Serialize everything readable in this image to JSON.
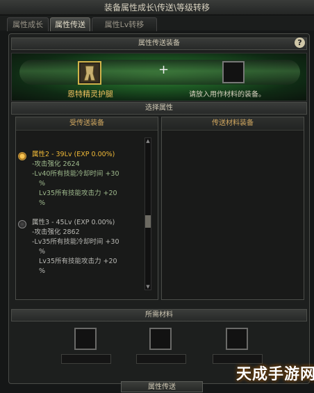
{
  "window": {
    "title": "装备属性成长\\传送\\等级转移"
  },
  "tabs": [
    {
      "label": "属性成长"
    },
    {
      "label": "属性传送",
      "active": true
    },
    {
      "label": "属性Lv转移"
    }
  ],
  "section_transfer": {
    "title": "属性传送装备",
    "help": "?",
    "source_item_name": "恩特精灵护腿",
    "plus": "+",
    "target_placeholder": "请放入用作材料的装备。"
  },
  "section_select": {
    "title": "选择属性",
    "left_title": "受传送装备",
    "right_title": "传送材料装备",
    "options": [
      {
        "selected": true,
        "name": "属性2 - 39Lv (EXP 0.00%)",
        "lines": [
          "-攻击强化 2624",
          "-Lv40所有技能冷却时间 +30",
          "%",
          "Lv35所有技能攻击力 +20",
          "%"
        ]
      },
      {
        "selected": false,
        "name": "属性3 - 45Lv (EXP 0.00%)",
        "lines": [
          "-攻击强化 2862",
          "-Lv35所有技能冷却时间 +30",
          "%",
          "Lv35所有技能攻击力 +20",
          "%"
        ]
      }
    ]
  },
  "section_materials": {
    "title": "所需材料"
  },
  "bottom_button": {
    "label": "属性传送"
  },
  "watermark": {
    "text": "天成手游网"
  },
  "colors": {
    "accent_gold": "#f1ba38",
    "option_green": "#9db88c",
    "banner_green": "#3b8f3a"
  }
}
